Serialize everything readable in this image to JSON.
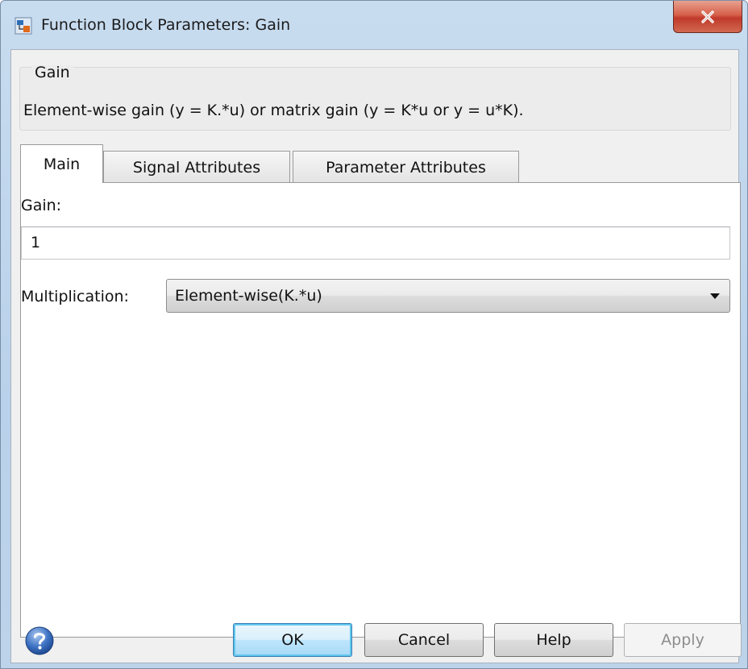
{
  "window": {
    "title": "Function Block Parameters: Gain",
    "close_label": "x"
  },
  "group": {
    "title": "Gain",
    "description": "Element-wise gain (y = K.*u) or matrix gain (y = K*u or y = u*K)."
  },
  "tabs": [
    {
      "label": "Main",
      "active": true
    },
    {
      "label": "Signal Attributes",
      "active": false
    },
    {
      "label": "Parameter Attributes",
      "active": false
    }
  ],
  "main": {
    "gain_label": "Gain:",
    "gain_value": "1",
    "multiplication_label": "Multiplication:",
    "multiplication_value": "Element-wise(K.*u)"
  },
  "buttons": {
    "ok": "OK",
    "cancel": "Cancel",
    "help": "Help",
    "apply": "Apply"
  },
  "icons": {
    "app": "simulink-block-icon",
    "close": "close-icon",
    "help": "help-question-icon",
    "dropdown": "chevron-down-icon"
  },
  "colors": {
    "close_button": "#c0392b",
    "titlebar": "#b9d1ea",
    "default_button_border": "#3c7fb1"
  }
}
